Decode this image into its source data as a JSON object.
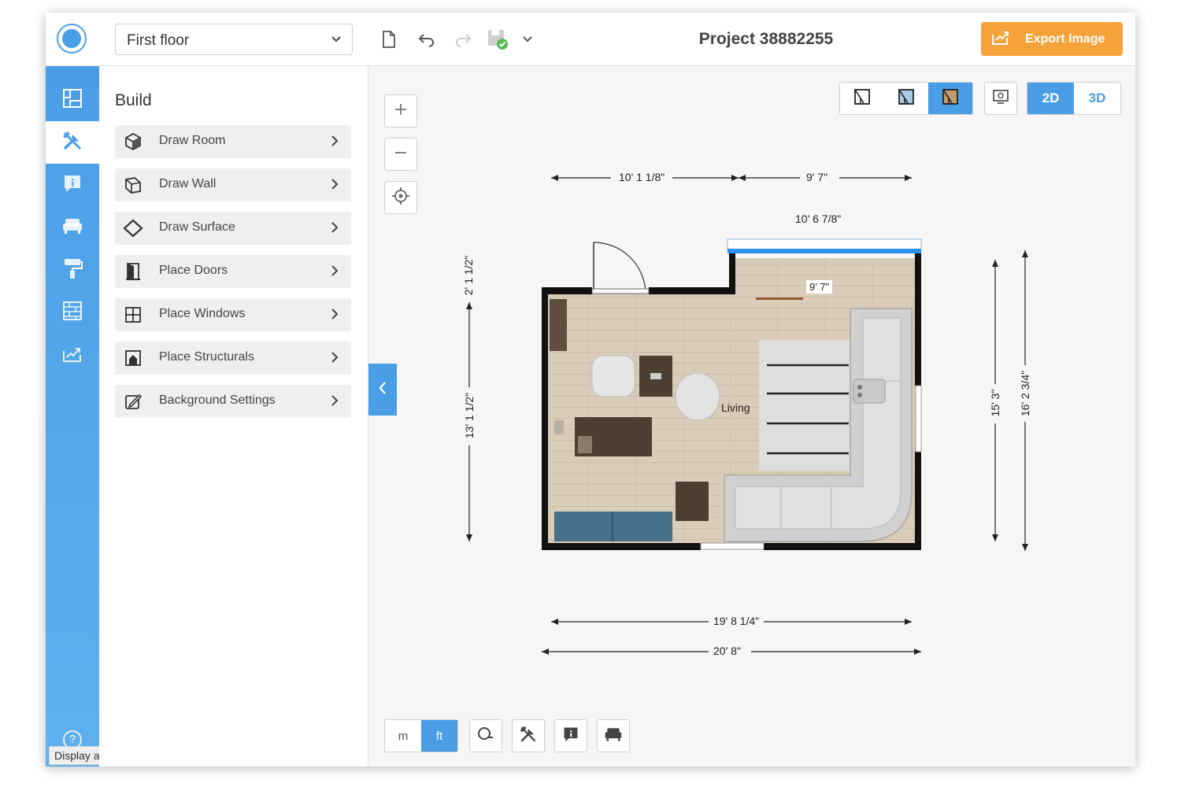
{
  "topbar": {
    "floor_value": "First floor",
    "project_title": "Project 38882255",
    "export_label": "Export Image"
  },
  "rail": {
    "items": [
      "floorplan-icon",
      "build-tools-icon",
      "info-icon",
      "furniture-icon",
      "paint-roller-icon",
      "materials-icon",
      "export-icon"
    ],
    "active_index": 1,
    "tooltip": "Display a menu",
    "help": "?"
  },
  "panel": {
    "title": "Build",
    "items": [
      {
        "label": "Draw Room",
        "icon": "cube-icon"
      },
      {
        "label": "Draw Wall",
        "icon": "wall-icon"
      },
      {
        "label": "Draw Surface",
        "icon": "surface-icon"
      },
      {
        "label": "Place Doors",
        "icon": "door-icon"
      },
      {
        "label": "Place Windows",
        "icon": "window-icon"
      },
      {
        "label": "Place Structurals",
        "icon": "structural-icon"
      },
      {
        "label": "Background Settings",
        "icon": "background-settings-icon"
      }
    ]
  },
  "canvas": {
    "view_modes": [
      "2D",
      "3D"
    ],
    "active_view": "2D",
    "units": [
      "m",
      "ft"
    ],
    "active_unit": "ft",
    "room_label": "Living",
    "dimensions": {
      "top_left": "10' 1 1/8\"",
      "top_right": "9' 7\"",
      "window_top": "10' 6 7/8\"",
      "inner_right": "9' 7\"",
      "left_upper": "2' 1 1/2\"",
      "left_lower": "13' 1 1/2\"",
      "right_inner": "15' 3\"",
      "right_outer": "16' 2 3/4\"",
      "bottom_inner": "19' 8 1/4\"",
      "bottom_outer": "20' 8\""
    }
  },
  "colors": {
    "accent": "#4a9ee6",
    "export": "#f5a23a",
    "wall": "#111111",
    "floor": "#d8cbb8"
  }
}
